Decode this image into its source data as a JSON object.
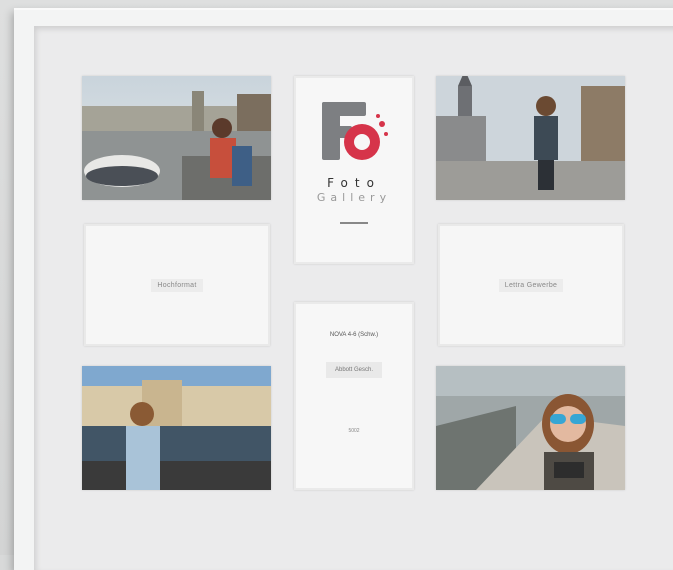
{
  "logo": {
    "monogram": "F",
    "title": "Foto",
    "subtitle": "Gallery"
  },
  "blank_cards": {
    "left_label": "Hochformat",
    "right_label": "Lettra Gewerbe"
  },
  "info_card": {
    "header": "NOVA 4-6 (Schw.)",
    "box_text": "Abbott Gesch.",
    "footer": "5002"
  },
  "colors": {
    "frame": "#f3f4f4",
    "mat": "#ebebec",
    "logo_red": "#d6344a",
    "logo_gray": "#7d7f82"
  }
}
